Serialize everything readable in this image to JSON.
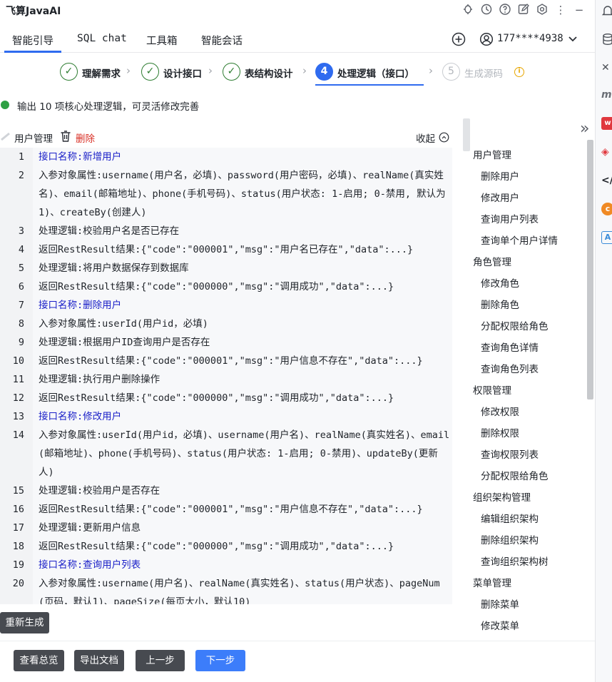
{
  "app_title": "飞算JavaAI",
  "tabs": [
    {
      "label": "智能引导"
    },
    {
      "label": "SQL chat"
    },
    {
      "label": "工具箱"
    },
    {
      "label": "智能会话"
    }
  ],
  "user": {
    "phone": "177****4938"
  },
  "steps": [
    {
      "number": "✓",
      "label": "理解需求"
    },
    {
      "number": "✓",
      "label": "设计接口"
    },
    {
      "number": "✓",
      "label": "表结构设计"
    },
    {
      "number": "4",
      "label": "处理逻辑（接口）"
    },
    {
      "number": "5",
      "label": "生成源码"
    }
  ],
  "status_text": "输出 10 项核心处理逻辑，可灵活修改完善",
  "group": {
    "title": "用户管理",
    "delete_label": "删除",
    "collapse_label": "收起"
  },
  "code_lines": [
    {
      "n": "1",
      "text": "接口名称:新增用户"
    },
    {
      "n": "2",
      "text": "入参对象属性:username(用户名，必填)、password(用户密码，必填)、realName(真实姓名)、email(邮箱地址)、phone(手机号码)、status(用户状态: 1-启用; 0-禁用, 默认为1)、createBy(创建人)"
    },
    {
      "n": "3",
      "text": "处理逻辑:校验用户名是否已存在"
    },
    {
      "n": "4",
      "text": "返回RestResult结果:{\"code\":\"000001\",\"msg\":\"用户名已存在\",\"data\":...}"
    },
    {
      "n": "5",
      "text": "处理逻辑:将用户数据保存到数据库"
    },
    {
      "n": "6",
      "text": "返回RestResult结果:{\"code\":\"000000\",\"msg\":\"调用成功\",\"data\":...}"
    },
    {
      "n": "7",
      "text": "接口名称:删除用户"
    },
    {
      "n": "8",
      "text": "入参对象属性:userId(用户id，必填)"
    },
    {
      "n": "9",
      "text": "处理逻辑:根据用户ID查询用户是否存在"
    },
    {
      "n": "10",
      "text": "返回RestResult结果:{\"code\":\"000001\",\"msg\":\"用户信息不存在\",\"data\":...}"
    },
    {
      "n": "11",
      "text": "处理逻辑:执行用户删除操作"
    },
    {
      "n": "12",
      "text": "返回RestResult结果:{\"code\":\"000000\",\"msg\":\"调用成功\",\"data\":...}"
    },
    {
      "n": "13",
      "text": "接口名称:修改用户"
    },
    {
      "n": "14",
      "text": "入参对象属性:userId(用户id，必填)、username(用户名)、realName(真实姓名)、email(邮箱地址)、phone(手机号码)、status(用户状态: 1-启用; 0-禁用)、updateBy(更新人)"
    },
    {
      "n": "15",
      "text": "处理逻辑:校验用户是否存在"
    },
    {
      "n": "16",
      "text": "返回RestResult结果:{\"code\":\"000001\",\"msg\":\"用户信息不存在\",\"data\":...}"
    },
    {
      "n": "17",
      "text": "处理逻辑:更新用户信息"
    },
    {
      "n": "18",
      "text": "返回RestResult结果:{\"code\":\"000000\",\"msg\":\"调用成功\",\"data\":...}"
    },
    {
      "n": "19",
      "text": "接口名称:查询用户列表"
    },
    {
      "n": "20",
      "text": "入参对象属性:username(用户名)、realName(真实姓名)、status(用户状态)、pageNum(页码，默认1)、pageSize(每页大小，默认10)"
    }
  ],
  "tree": [
    {
      "type": "group",
      "label": "用户管理"
    },
    {
      "type": "item",
      "label": "删除用户"
    },
    {
      "type": "item",
      "label": "修改用户"
    },
    {
      "type": "item",
      "label": "查询用户列表"
    },
    {
      "type": "item",
      "label": "查询单个用户详情"
    },
    {
      "type": "group",
      "label": "角色管理"
    },
    {
      "type": "item",
      "label": "修改角色"
    },
    {
      "type": "item",
      "label": "删除角色"
    },
    {
      "type": "item",
      "label": "分配权限给角色"
    },
    {
      "type": "item",
      "label": "查询角色详情"
    },
    {
      "type": "item",
      "label": "查询角色列表"
    },
    {
      "type": "group",
      "label": "权限管理"
    },
    {
      "type": "item",
      "label": "修改权限"
    },
    {
      "type": "item",
      "label": "删除权限"
    },
    {
      "type": "item",
      "label": "查询权限列表"
    },
    {
      "type": "item",
      "label": "分配权限给角色"
    },
    {
      "type": "group",
      "label": "组织架构管理"
    },
    {
      "type": "item",
      "label": "编辑组织架构"
    },
    {
      "type": "item",
      "label": "删除组织架构"
    },
    {
      "type": "item",
      "label": "查询组织架构树"
    },
    {
      "type": "group",
      "label": "菜单管理"
    },
    {
      "type": "item",
      "label": "删除菜单"
    },
    {
      "type": "item",
      "label": "修改菜单"
    }
  ],
  "buttons": {
    "regenerate": "重新生成",
    "overview": "查看总览",
    "export": "导出文档",
    "prev": "上一步",
    "next": "下一步"
  },
  "colors": {
    "primary": "#3c7dfa",
    "step_done": "#2e7d32",
    "danger": "#d93026",
    "api_name": "#1a1fc8"
  }
}
